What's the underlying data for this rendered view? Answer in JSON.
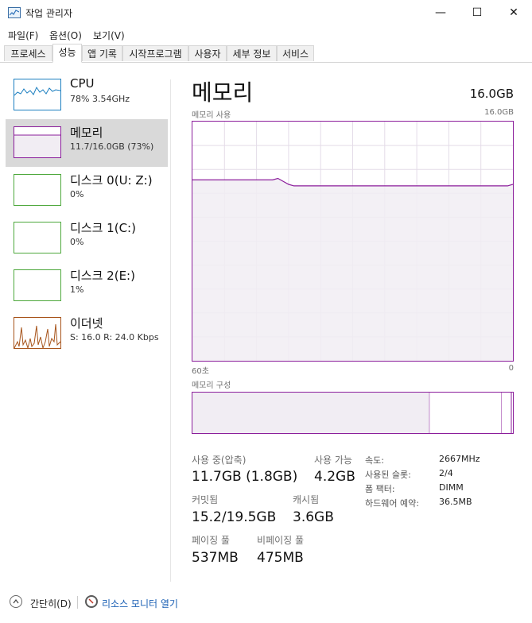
{
  "window": {
    "title": "작업 관리자",
    "minimize": "—",
    "maximize": "☐",
    "close": "✕"
  },
  "menu": [
    "파일(F)",
    "옵션(O)",
    "보기(V)"
  ],
  "tabs": [
    "프로세스",
    "성능",
    "앱 기록",
    "시작프로그램",
    "사용자",
    "세부 정보",
    "서비스"
  ],
  "active_tab": "성능",
  "sidebar": [
    {
      "title": "CPU",
      "subtitle": "78% 3.54GHz",
      "color": "#1c7fc0"
    },
    {
      "title": "메모리",
      "subtitle": "11.7/16.0GB (73%)",
      "color": "#8b1d9b",
      "selected": true
    },
    {
      "title": "디스크 0(U: Z:)",
      "subtitle": "0%",
      "color": "#4da83c"
    },
    {
      "title": "디스크 1(C:)",
      "subtitle": "0%",
      "color": "#4da83c"
    },
    {
      "title": "디스크 2(E:)",
      "subtitle": "1%",
      "color": "#4da83c"
    },
    {
      "title": "이더넷",
      "subtitle": "S: 16.0 R: 24.0 Kbps",
      "color": "#a7541b"
    }
  ],
  "main": {
    "heading": "메모리",
    "total": "16.0GB",
    "usage_label": "메모리 사용",
    "usage_max": "16.0GB",
    "time_left": "60초",
    "time_right": "0",
    "composition_label": "메모리 구성"
  },
  "chart_data": {
    "type": "area",
    "ylim": [
      0,
      16.0
    ],
    "x_range_seconds": [
      60,
      0
    ],
    "values_gb": [
      12.1,
      12.1,
      12.1,
      12.1,
      12.1,
      12.1,
      12.1,
      12.1,
      12.1,
      12.1,
      12.1,
      12.1,
      12.1,
      12.1,
      12.1,
      12.1,
      12.2,
      12.0,
      11.8,
      11.7,
      11.7,
      11.7,
      11.7,
      11.7,
      11.7,
      11.7,
      11.7,
      11.7,
      11.7,
      11.7,
      11.7,
      11.7,
      11.7,
      11.7,
      11.7,
      11.7,
      11.7,
      11.7,
      11.7,
      11.7,
      11.7,
      11.7,
      11.7,
      11.7,
      11.7,
      11.7,
      11.7,
      11.7,
      11.7,
      11.7,
      11.7,
      11.7,
      11.7,
      11.7,
      11.7,
      11.7,
      11.7,
      11.7,
      11.7,
      11.7,
      11.8
    ],
    "color": "#8b1d9b",
    "fill": "#f1edf3",
    "grid": true
  },
  "composition": {
    "in_use_fraction": 0.74,
    "modified_fraction": 0.225,
    "standby_fraction": 0.03
  },
  "stats": {
    "in_use_label": "사용 중(압축)",
    "in_use_value": "11.7GB (1.8GB)",
    "available_label": "사용 가능",
    "available_value": "4.2GB",
    "committed_label": "커밋됨",
    "committed_value": "15.2/19.5GB",
    "cached_label": "캐시됨",
    "cached_value": "3.6GB",
    "paged_label": "페이징 풀",
    "paged_value": "537MB",
    "nonpaged_label": "비페이징 풀",
    "nonpaged_value": "475MB"
  },
  "details": [
    {
      "label": "속도:",
      "value": "2667MHz"
    },
    {
      "label": "사용된 슬롯:",
      "value": "2/4"
    },
    {
      "label": "폼 팩터:",
      "value": "DIMM"
    },
    {
      "label": "하드웨어 예약:",
      "value": "36.5MB"
    }
  ],
  "footer": {
    "fewer": "간단히(D)",
    "resmon": "리소스 모니터 열기"
  }
}
